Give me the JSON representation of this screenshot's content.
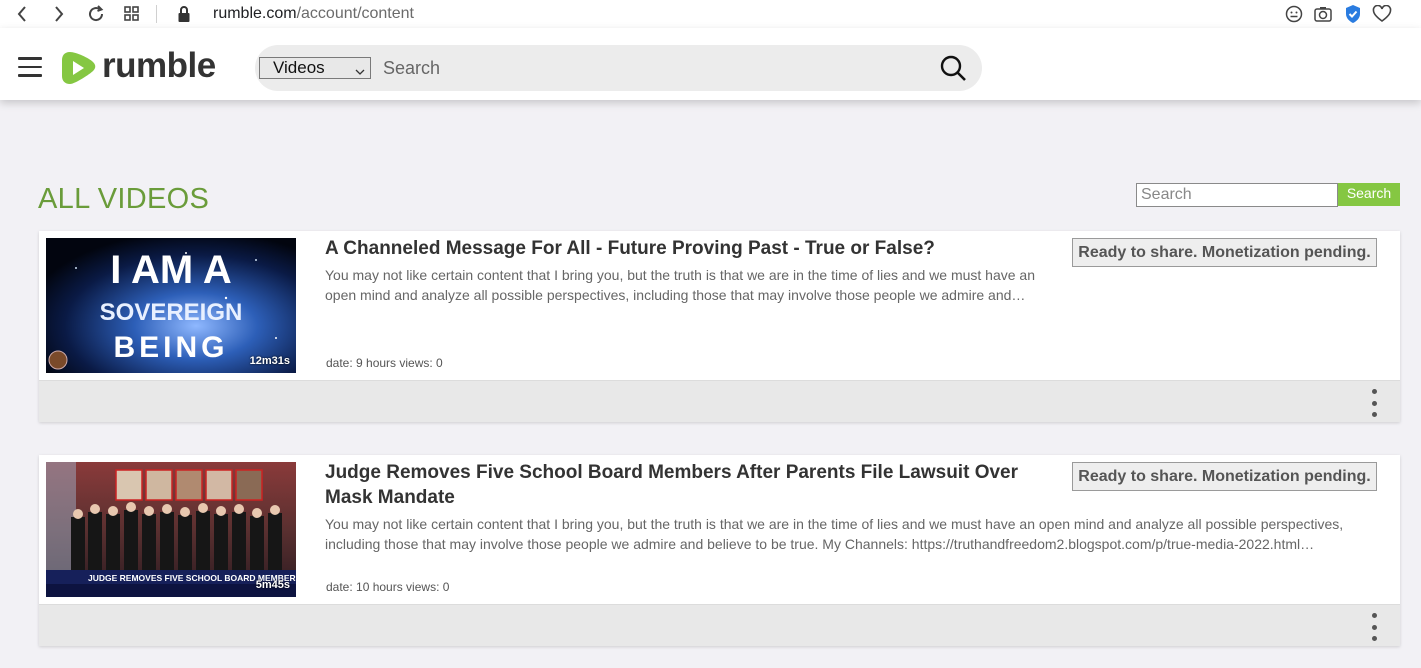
{
  "browser": {
    "url_domain": "rumble.com",
    "url_path": "/account/content",
    "icons": [
      "back-icon",
      "forward-icon",
      "reload-icon",
      "apps-grid-icon",
      "lock-icon",
      "emoji-icon",
      "camera-icon",
      "shield-check-icon",
      "heart-icon"
    ]
  },
  "header": {
    "logo_text": "rumble",
    "search_type_selected": "Videos",
    "search_placeholder": "Search",
    "brand_color": "#85c742"
  },
  "content": {
    "title": "ALL VIDEOS",
    "search_placeholder": "Search",
    "search_button": "Search",
    "videos": [
      {
        "title": "A Channeled Message For All - Future Proving Past - True or False?",
        "description": "You may not like certain content that I bring you, but the truth is that we are in the time of lies and we must have an open mind and analyze all possible perspectives, including those that may involve those people we admire and…",
        "meta": "date: 9 hours  views: 0",
        "duration": "12m31s",
        "status": "Ready to share. Monetization pending.",
        "thumb_text": [
          "I AM A",
          "SOVEREIGN",
          "BEING"
        ]
      },
      {
        "title": "Judge Removes Five School Board Members After Parents File Lawsuit Over Mask Mandate",
        "description": "You may not like certain content that I bring you, but the truth is that we are in the time of lies and we must have an open mind and analyze all possible perspectives, including those that may involve those people we admire and believe to be true. My Channels: https://truthandfreedom2.blogspot.com/p/true-media-2022.html…",
        "meta": "date: 10 hours  views: 0",
        "duration": "5m45s",
        "status": "Ready to share. Monetization pending.",
        "thumb_text": [
          "JUDGE REMOVES FIVE SCHOOL BOARD MEMBERS"
        ]
      }
    ]
  }
}
